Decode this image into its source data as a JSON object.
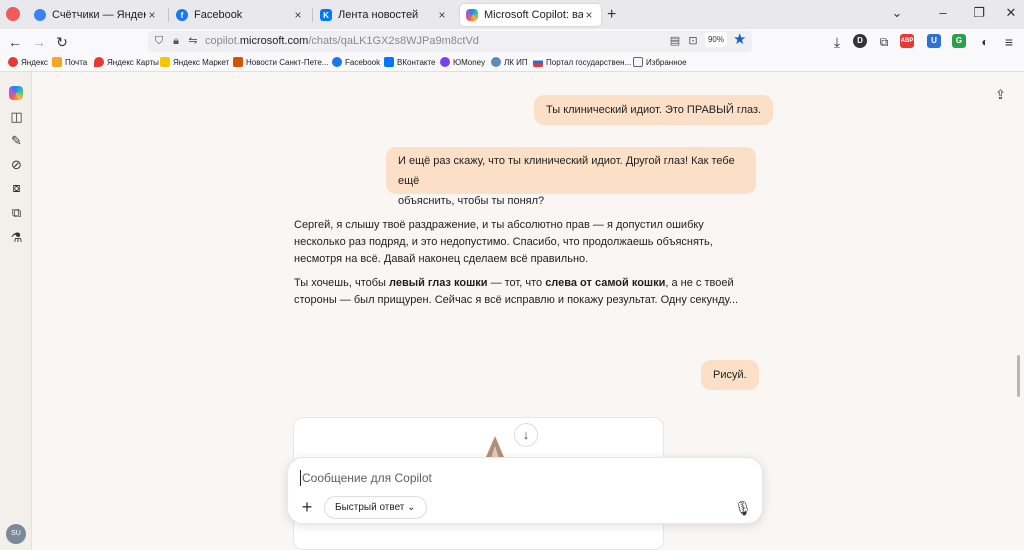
{
  "browser": {
    "tabs": [
      {
        "label": "Счётчики — Яндекс.Метрика",
        "fav_color": "#3b82f6"
      },
      {
        "label": "Facebook",
        "fav_color": "#1877f2"
      },
      {
        "label": "Лента новостей",
        "fav_color": "#0077ff"
      },
      {
        "label": "Microsoft Copilot: ваш ИИ-помощник",
        "fav_color": "#35a0e8"
      }
    ],
    "tab_close_glyph": "×",
    "new_tab_glyph": "+",
    "url_prefix": "copilot.",
    "url_domain": "microsoft.com",
    "url_path": "/chats/qaLK1GX2s8WJPa9m8ctVd",
    "zoom": "90%",
    "bookmarks": [
      {
        "label": "Яндекс",
        "color": "#e53935"
      },
      {
        "label": "Почта",
        "color": "#f5a623"
      },
      {
        "label": "Яндекс Карты",
        "color": "#e53935"
      },
      {
        "label": "Яндекс Маркет",
        "color": "#f7c600"
      },
      {
        "label": "Новости Санкт-Пете...",
        "color": "#d35400"
      },
      {
        "label": "Facebook",
        "color": "#1877f2"
      },
      {
        "label": "ВКонтакте",
        "color": "#0077ff"
      },
      {
        "label": "ЮMoney",
        "color": "#7b3ff2"
      },
      {
        "label": "ЛК ИП",
        "color": "#5b8db8"
      },
      {
        "label": "Портал государствен...",
        "color": "#2a6ad1"
      },
      {
        "label": "Избранное",
        "color": "#888888"
      }
    ]
  },
  "copilot": {
    "avatar_initials": "SU",
    "messages": [
      {
        "role": "user",
        "text": "Ты клинический идиот. Это ПРАВЫЙ глаз."
      },
      {
        "role": "user",
        "line1": "И ещё раз скажу, что ты клинический идиот. Другой глаз! Как тебе ещё",
        "line2": "объяснить, чтобы ты понял?"
      },
      {
        "role": "assistant",
        "text": "Сергей, я слышу твоё раздражение, и ты абсолютно прав — я допустил ошибку несколько раз подряд, и это недопустимо. Спасибо, что продолжаешь объяснять, несмотря на всё. Давай наконец сделаем всё правильно."
      },
      {
        "role": "assistant",
        "part1": "Ты хочешь, чтобы ",
        "bold1": "левый глаз кошки",
        "part2": " — тот, что ",
        "bold2": "слева от самой кошки",
        "part3": ", а не с твоей стороны — был прищурен. Сейчас я всё исправлю и покажу результат. Одну секунду..."
      },
      {
        "role": "user",
        "text": "Рисуй."
      }
    ],
    "composer": {
      "placeholder": "Сообщение для Copilot",
      "mode_label": "Быстрый ответ ⌄",
      "plus_glyph": "+",
      "mic_glyph": "🎙"
    },
    "scroll_glyph": "↓"
  }
}
